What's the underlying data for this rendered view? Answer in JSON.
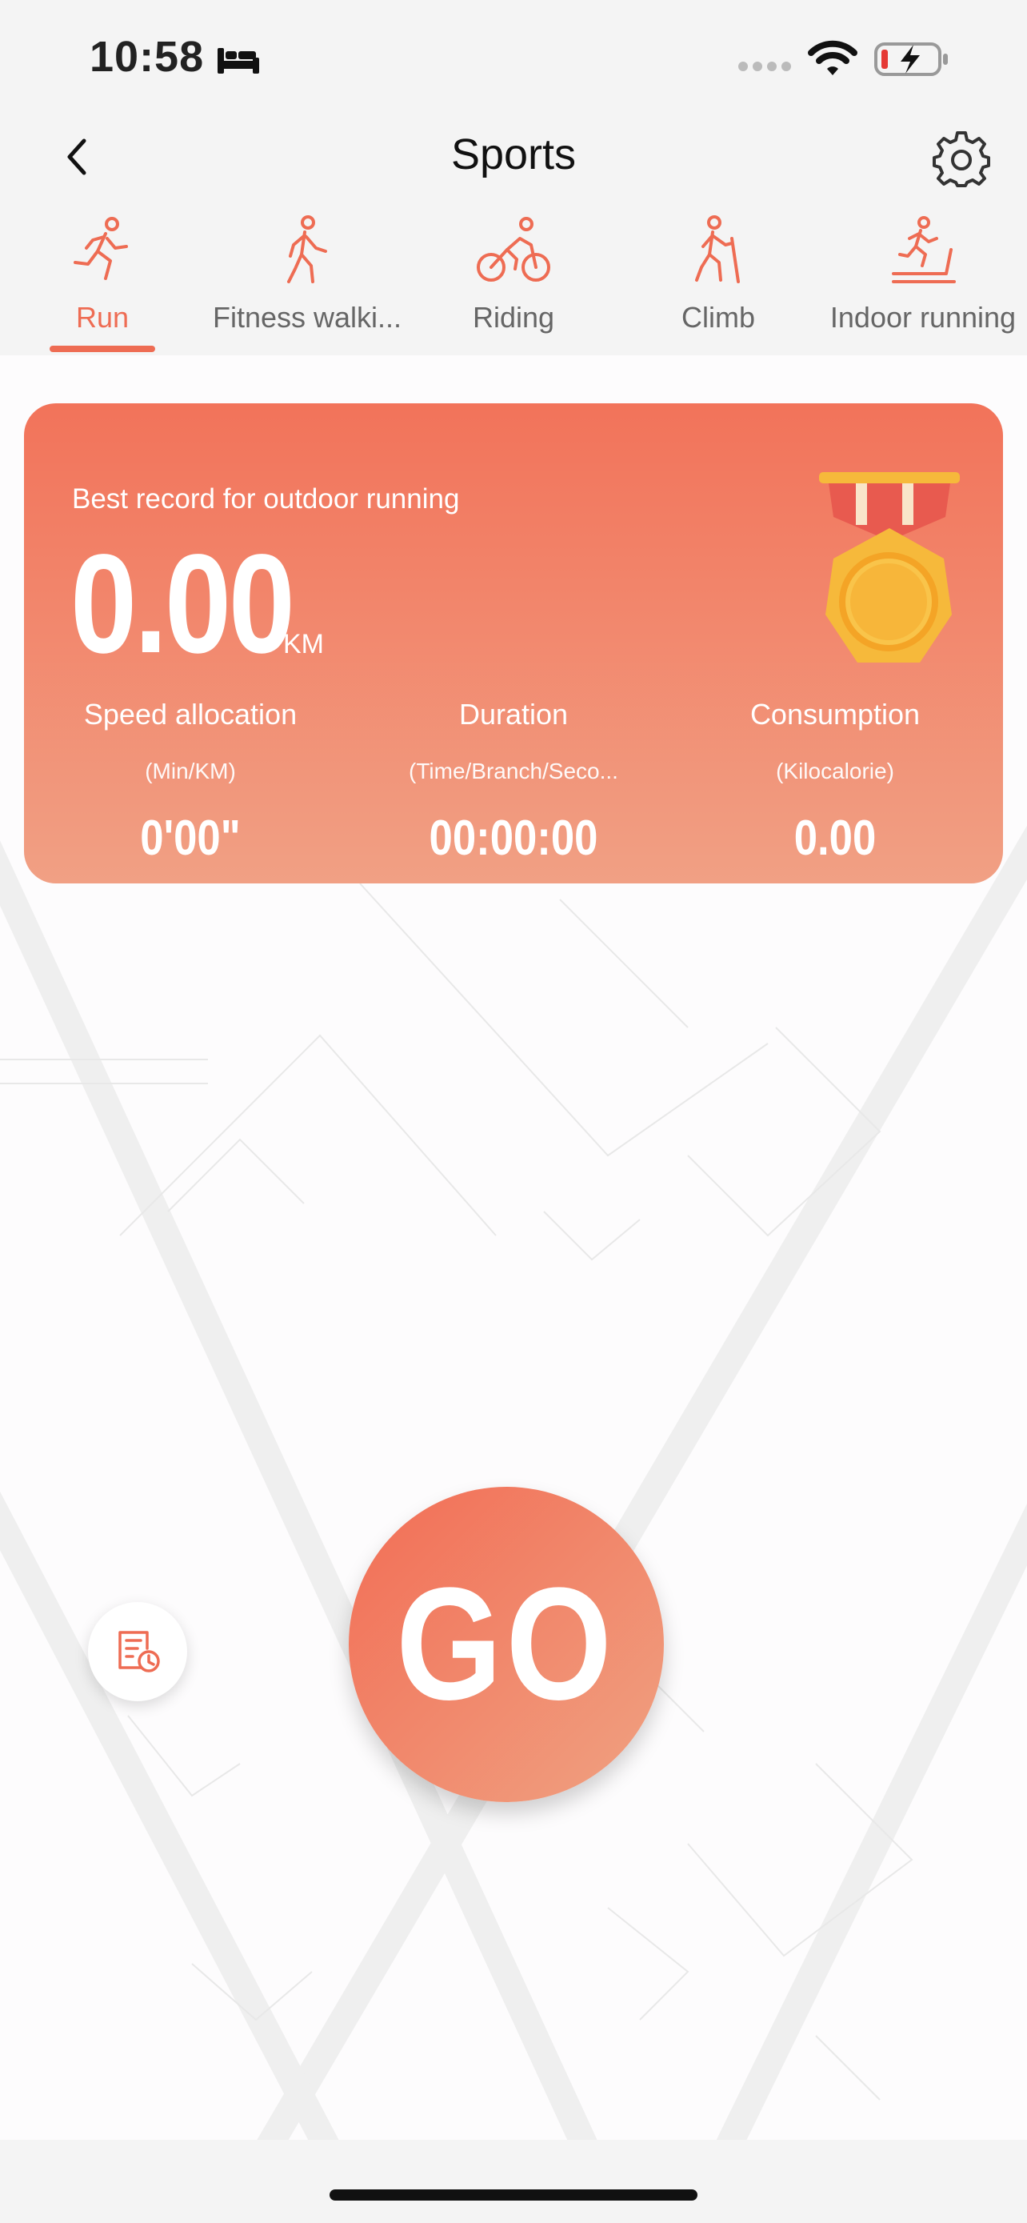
{
  "status_bar": {
    "time": "10:58",
    "icons": [
      "bed-icon",
      "signal-icon",
      "wifi-icon",
      "battery-icon"
    ]
  },
  "nav": {
    "title": "Sports",
    "back_icon": "chevron-left-icon",
    "settings_icon": "gear-icon"
  },
  "tabs": [
    {
      "label": "Run",
      "icon": "run-icon",
      "active": true
    },
    {
      "label": "Fitness walki...",
      "icon": "walk-icon",
      "active": false
    },
    {
      "label": "Riding",
      "icon": "bike-icon",
      "active": false
    },
    {
      "label": "Climb",
      "icon": "climb-icon",
      "active": false
    },
    {
      "label": "Indoor running",
      "icon": "treadmill-icon",
      "active": false
    }
  ],
  "record": {
    "title": "Best record for outdoor running",
    "value": "0.00",
    "unit": "KM",
    "stats": [
      {
        "label": "Speed allocation",
        "unit": "(Min/KM)",
        "value": "0'00\""
      },
      {
        "label": "Duration",
        "unit": "(Time/Branch/Seco...",
        "value": "00:00:00"
      },
      {
        "label": "Consumption",
        "unit": "(Kilocalorie)",
        "value": "0.00"
      }
    ]
  },
  "go_label": "GO",
  "colors": {
    "accent": "#ee6c53",
    "card_top": "#f2735a",
    "card_bottom": "#f1a084",
    "medal": "#f6b93b"
  }
}
